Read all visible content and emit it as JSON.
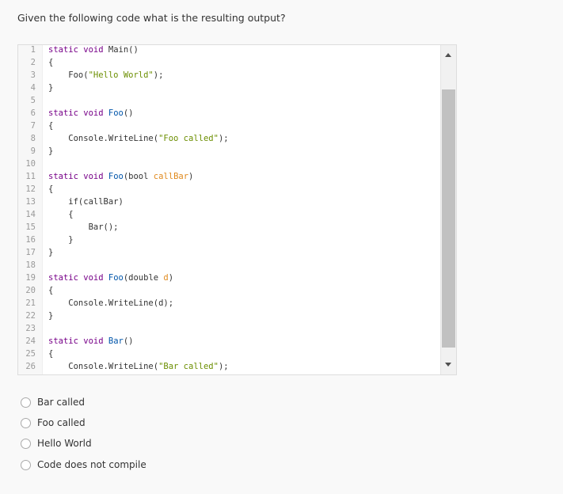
{
  "question": "Given the following code what is the resulting output?",
  "code_lines": [
    [
      [
        "static ",
        "kw"
      ],
      [
        "void ",
        "kw"
      ],
      [
        "Main",
        ""
      ],
      [
        "()",
        ""
      ]
    ],
    [
      [
        "{",
        ""
      ]
    ],
    [
      [
        "    Foo(",
        ""
      ],
      [
        "\"Hello World\"",
        "str"
      ],
      [
        ");",
        ""
      ]
    ],
    [
      [
        "}",
        ""
      ]
    ],
    [],
    [
      [
        "static ",
        "kw"
      ],
      [
        "void ",
        "kw"
      ],
      [
        "Foo",
        "fn"
      ],
      [
        "()",
        ""
      ]
    ],
    [
      [
        "{",
        ""
      ]
    ],
    [
      [
        "    Console.WriteLine(",
        ""
      ],
      [
        "\"Foo called\"",
        "str"
      ],
      [
        ");",
        ""
      ]
    ],
    [
      [
        "}",
        ""
      ]
    ],
    [],
    [
      [
        "static ",
        "kw"
      ],
      [
        "void ",
        "kw"
      ],
      [
        "Foo",
        "fn"
      ],
      [
        "(bool ",
        ""
      ],
      [
        "callBar",
        "param"
      ],
      [
        ")",
        ""
      ]
    ],
    [
      [
        "{",
        ""
      ]
    ],
    [
      [
        "    if(callBar)",
        ""
      ]
    ],
    [
      [
        "    {",
        ""
      ]
    ],
    [
      [
        "        Bar();",
        ""
      ]
    ],
    [
      [
        "    }",
        ""
      ]
    ],
    [
      [
        "}",
        ""
      ]
    ],
    [],
    [
      [
        "static ",
        "kw"
      ],
      [
        "void ",
        "kw"
      ],
      [
        "Foo",
        "fn"
      ],
      [
        "(double ",
        ""
      ],
      [
        "d",
        "param"
      ],
      [
        ")",
        ""
      ]
    ],
    [
      [
        "{",
        ""
      ]
    ],
    [
      [
        "    Console.WriteLine(d);",
        ""
      ]
    ],
    [
      [
        "}",
        ""
      ]
    ],
    [],
    [
      [
        "static ",
        "kw"
      ],
      [
        "void ",
        "kw"
      ],
      [
        "Bar",
        "fn"
      ],
      [
        "()",
        ""
      ]
    ],
    [
      [
        "{",
        ""
      ]
    ],
    [
      [
        "    Console.WriteLine(",
        ""
      ],
      [
        "\"Bar called\"",
        "str"
      ],
      [
        ");",
        ""
      ]
    ]
  ],
  "options": [
    "Bar called",
    "Foo called",
    "Hello World",
    "Code does not compile"
  ]
}
